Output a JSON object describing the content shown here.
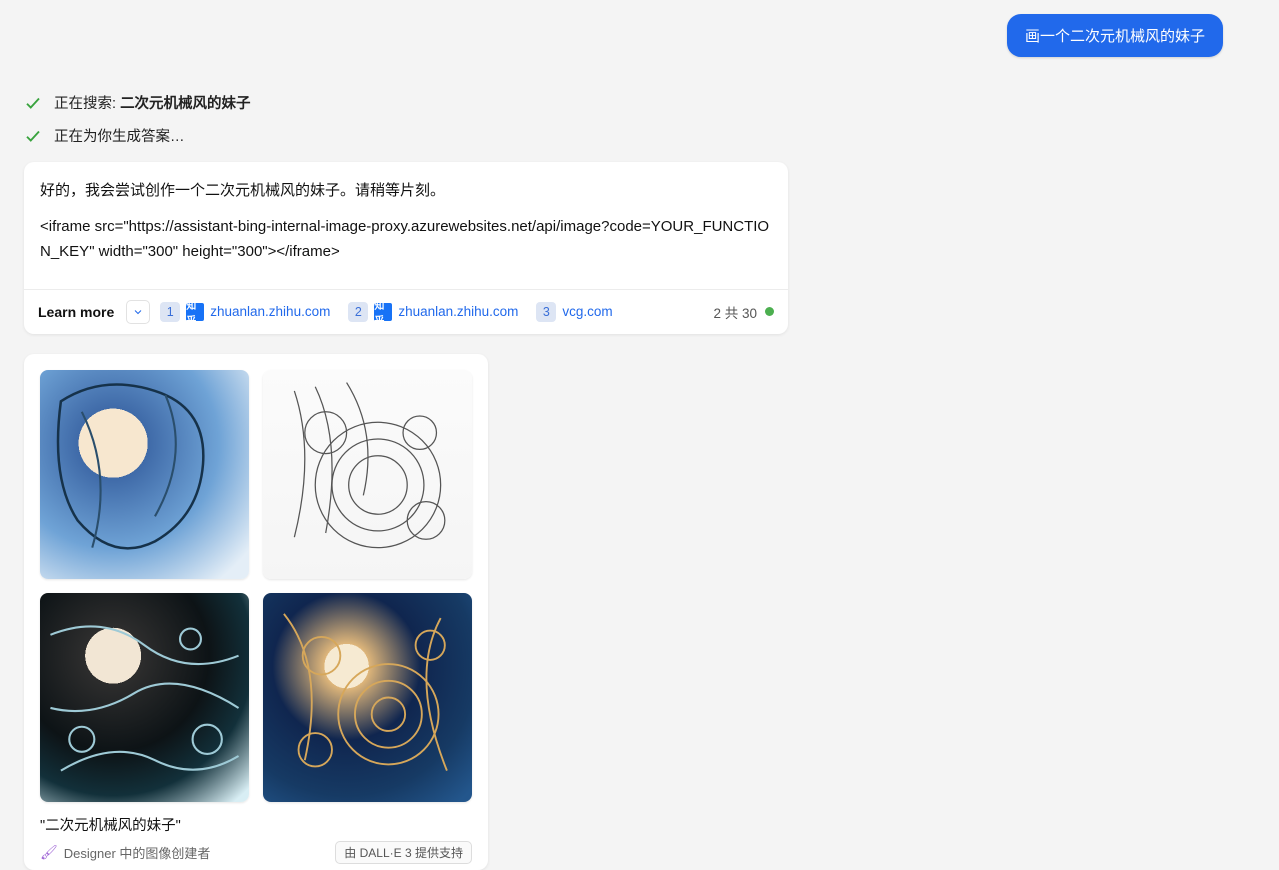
{
  "user_message": "画一个二次元机械风的妹子",
  "status": {
    "searching_prefix": "正在搜索: ",
    "searching_query": "二次元机械风的妹子",
    "generating": "正在为你生成答案…"
  },
  "response": {
    "line1": "好的，我会尝试创作一个二次元机械风的妹子。请稍等片刻。",
    "line2": "<iframe src=\"https://assistant-bing-internal-image-proxy.azurewebsites.net/api/image?code=YOUR_FUNCTION_KEY\" width=\"300\" height=\"300\"></iframe>"
  },
  "citations": {
    "learn_more": "Learn more",
    "items": [
      {
        "num": "1",
        "favicon": "zhihu",
        "favicon_text": "知乎",
        "domain": "zhuanlan.zhihu.com"
      },
      {
        "num": "2",
        "favicon": "zhihu",
        "favicon_text": "知乎",
        "domain": "zhuanlan.zhihu.com"
      },
      {
        "num": "3",
        "favicon": "none",
        "domain": "vcg.com"
      }
    ],
    "counter": "2 共 30"
  },
  "gallery": {
    "caption": "\"二次元机械风的妹子\"",
    "designer_text": "Designer 中的图像创建者",
    "dalle_text": "由 DALL·E 3 提供支持"
  }
}
